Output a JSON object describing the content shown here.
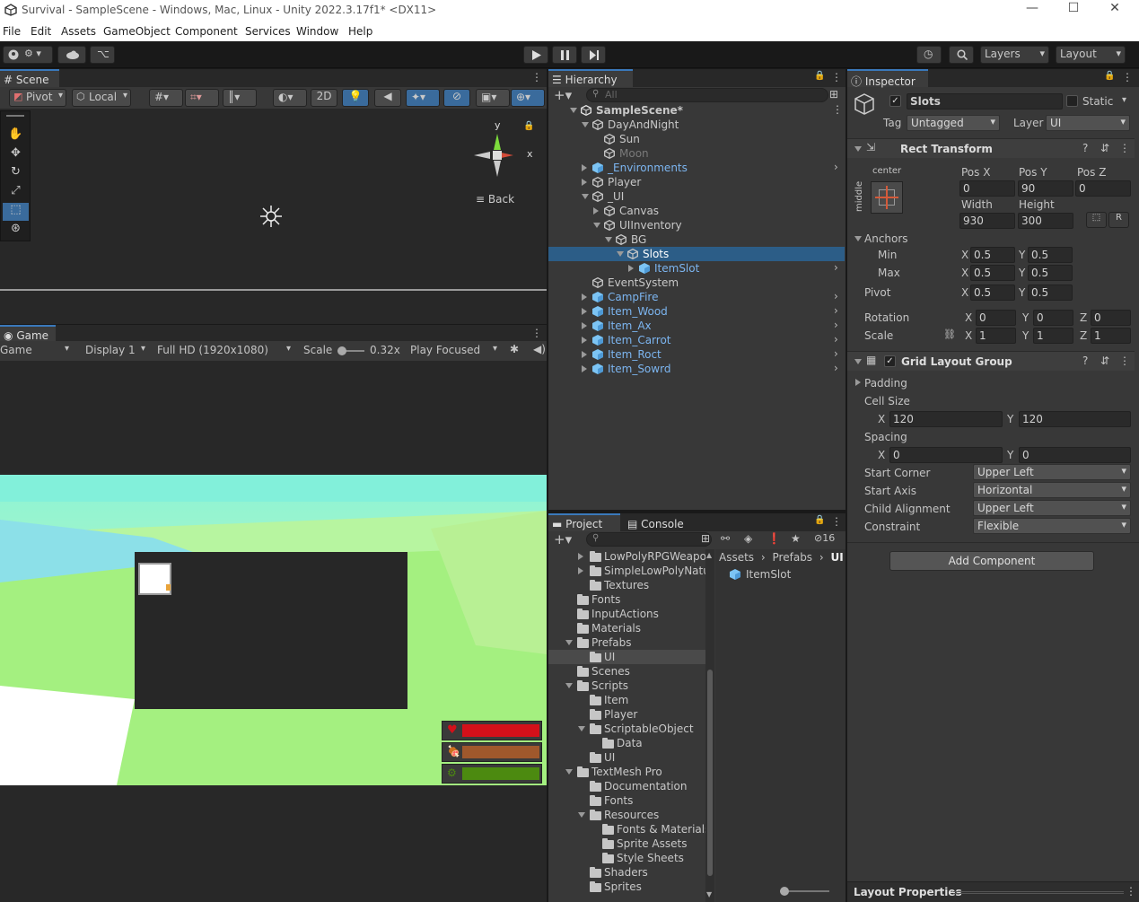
{
  "window": {
    "title": "Survival - SampleScene - Windows, Mac, Linux - Unity 2022.3.17f1* <DX11>",
    "minimize": "—",
    "maximize": "☐",
    "close": "✕"
  },
  "menu": [
    "File",
    "Edit",
    "Assets",
    "GameObject",
    "Component",
    "Services",
    "Window",
    "Help"
  ],
  "toolbar": {
    "layers": "Layers",
    "layout": "Layout"
  },
  "scene": {
    "tab": "Scene",
    "pivot": "Pivot",
    "local": "Local",
    "twod": "2D",
    "back": "Back",
    "axis_y": "y",
    "axis_x": "x"
  },
  "game": {
    "tab": "Game",
    "mode": "Game",
    "display": "Display 1",
    "resolution": "Full HD (1920x1080)",
    "scale_label": "Scale",
    "scale_value": "0.32x",
    "play_focused": "Play Focused",
    "bars": [
      {
        "color": "#d3101a"
      },
      {
        "color": "#a0582c"
      },
      {
        "color": "#4c8a10"
      }
    ]
  },
  "hierarchy": {
    "tab": "Hierarchy",
    "search_placeholder": "All",
    "rows": [
      {
        "label": "SampleScene*",
        "depth": 0,
        "expand": "down",
        "kind": "scene"
      },
      {
        "label": "DayAndNight",
        "depth": 1,
        "expand": "down",
        "kind": "go"
      },
      {
        "label": "Sun",
        "depth": 2,
        "expand": "none",
        "kind": "go"
      },
      {
        "label": "Moon",
        "depth": 2,
        "expand": "none",
        "kind": "go",
        "dim": true
      },
      {
        "label": "_Environments",
        "depth": 1,
        "expand": "right",
        "kind": "prefab",
        "arrow": true
      },
      {
        "label": "Player",
        "depth": 1,
        "expand": "right",
        "kind": "go"
      },
      {
        "label": "_UI",
        "depth": 1,
        "expand": "down",
        "kind": "go"
      },
      {
        "label": "Canvas",
        "depth": 2,
        "expand": "right",
        "kind": "go"
      },
      {
        "label": "UIInventory",
        "depth": 2,
        "expand": "down",
        "kind": "go"
      },
      {
        "label": "BG",
        "depth": 3,
        "expand": "down",
        "kind": "go"
      },
      {
        "label": "Slots",
        "depth": 4,
        "expand": "down",
        "kind": "go",
        "selected": true
      },
      {
        "label": "ItemSlot",
        "depth": 5,
        "expand": "right",
        "kind": "prefab",
        "arrow": true
      },
      {
        "label": "EventSystem",
        "depth": 1,
        "expand": "none",
        "kind": "go"
      },
      {
        "label": "CampFire",
        "depth": 1,
        "expand": "right",
        "kind": "prefab",
        "arrow": true
      },
      {
        "label": "Item_Wood",
        "depth": 1,
        "expand": "right",
        "kind": "prefab",
        "arrow": true
      },
      {
        "label": "Item_Ax",
        "depth": 1,
        "expand": "right",
        "kind": "prefab",
        "arrow": true
      },
      {
        "label": "Item_Carrot",
        "depth": 1,
        "expand": "right",
        "kind": "prefab",
        "arrow": true
      },
      {
        "label": "Item_Roct",
        "depth": 1,
        "expand": "right",
        "kind": "prefab",
        "arrow": true
      },
      {
        "label": "Item_Sowrd",
        "depth": 1,
        "expand": "right",
        "kind": "prefab",
        "arrow": true
      }
    ]
  },
  "project": {
    "tab": "Project",
    "console_tab": "Console",
    "hidden_count": "16",
    "breadcrumb": [
      "Assets",
      "Prefabs",
      "UI"
    ],
    "asset": "ItemSlot",
    "tree": [
      {
        "label": "LowPolyRPGWeapons",
        "depth": 2,
        "expand": "right"
      },
      {
        "label": "SimpleLowPolyNature",
        "depth": 2,
        "expand": "right"
      },
      {
        "label": "Textures",
        "depth": 2,
        "expand": "none"
      },
      {
        "label": "Fonts",
        "depth": 1,
        "expand": "none"
      },
      {
        "label": "InputActions",
        "depth": 1,
        "expand": "none"
      },
      {
        "label": "Materials",
        "depth": 1,
        "expand": "none"
      },
      {
        "label": "Prefabs",
        "depth": 1,
        "expand": "down"
      },
      {
        "label": "UI",
        "depth": 2,
        "expand": "none",
        "selected": true
      },
      {
        "label": "Scenes",
        "depth": 1,
        "expand": "none"
      },
      {
        "label": "Scripts",
        "depth": 1,
        "expand": "down"
      },
      {
        "label": "Item",
        "depth": 2,
        "expand": "none"
      },
      {
        "label": "Player",
        "depth": 2,
        "expand": "none"
      },
      {
        "label": "ScriptableObject",
        "depth": 2,
        "expand": "down"
      },
      {
        "label": "Data",
        "depth": 3,
        "expand": "none"
      },
      {
        "label": "UI",
        "depth": 2,
        "expand": "none"
      },
      {
        "label": "TextMesh Pro",
        "depth": 1,
        "expand": "down"
      },
      {
        "label": "Documentation",
        "depth": 2,
        "expand": "none"
      },
      {
        "label": "Fonts",
        "depth": 2,
        "expand": "none"
      },
      {
        "label": "Resources",
        "depth": 2,
        "expand": "down"
      },
      {
        "label": "Fonts & Materials",
        "depth": 3,
        "expand": "none"
      },
      {
        "label": "Sprite Assets",
        "depth": 3,
        "expand": "none"
      },
      {
        "label": "Style Sheets",
        "depth": 3,
        "expand": "none"
      },
      {
        "label": "Shaders",
        "depth": 2,
        "expand": "none"
      },
      {
        "label": "Sprites",
        "depth": 2,
        "expand": "none"
      }
    ]
  },
  "inspector": {
    "tab": "Inspector",
    "name": "Slots",
    "static": "Static",
    "tag_label": "Tag",
    "tag_value": "Untagged",
    "layer_label": "Layer",
    "layer_value": "UI",
    "rect": {
      "title": "Rect Transform",
      "anchor_h": "center",
      "anchor_v": "middle",
      "posx_label": "Pos X",
      "posy_label": "Pos Y",
      "posz_label": "Pos Z",
      "posx": "0",
      "posy": "90",
      "posz": "0",
      "width_label": "Width",
      "height_label": "Height",
      "width": "930",
      "height": "300",
      "r_btn": "R",
      "anchors": "Anchors",
      "min": "Min",
      "max": "Max",
      "pivot": "Pivot",
      "min_x": "0.5",
      "min_y": "0.5",
      "max_x": "0.5",
      "max_y": "0.5",
      "pivot_x": "0.5",
      "pivot_y": "0.5",
      "rotation": "Rotation",
      "scale": "Scale",
      "rot_x": "0",
      "rot_y": "0",
      "rot_z": "0",
      "sc_x": "1",
      "sc_y": "1",
      "sc_z": "1",
      "x": "X",
      "y": "Y",
      "z": "Z"
    },
    "grid": {
      "title": "Grid Layout Group",
      "padding": "Padding",
      "cell_size": "Cell Size",
      "cell_x": "120",
      "cell_y": "120",
      "spacing": "Spacing",
      "sp_x": "0",
      "sp_y": "0",
      "start_corner": "Start Corner",
      "start_corner_v": "Upper Left",
      "start_axis": "Start Axis",
      "start_axis_v": "Horizontal",
      "child_alignment": "Child Alignment",
      "child_alignment_v": "Upper Left",
      "constraint": "Constraint",
      "constraint_v": "Flexible"
    },
    "add_component": "Add Component",
    "layout_properties": "Layout Properties"
  }
}
